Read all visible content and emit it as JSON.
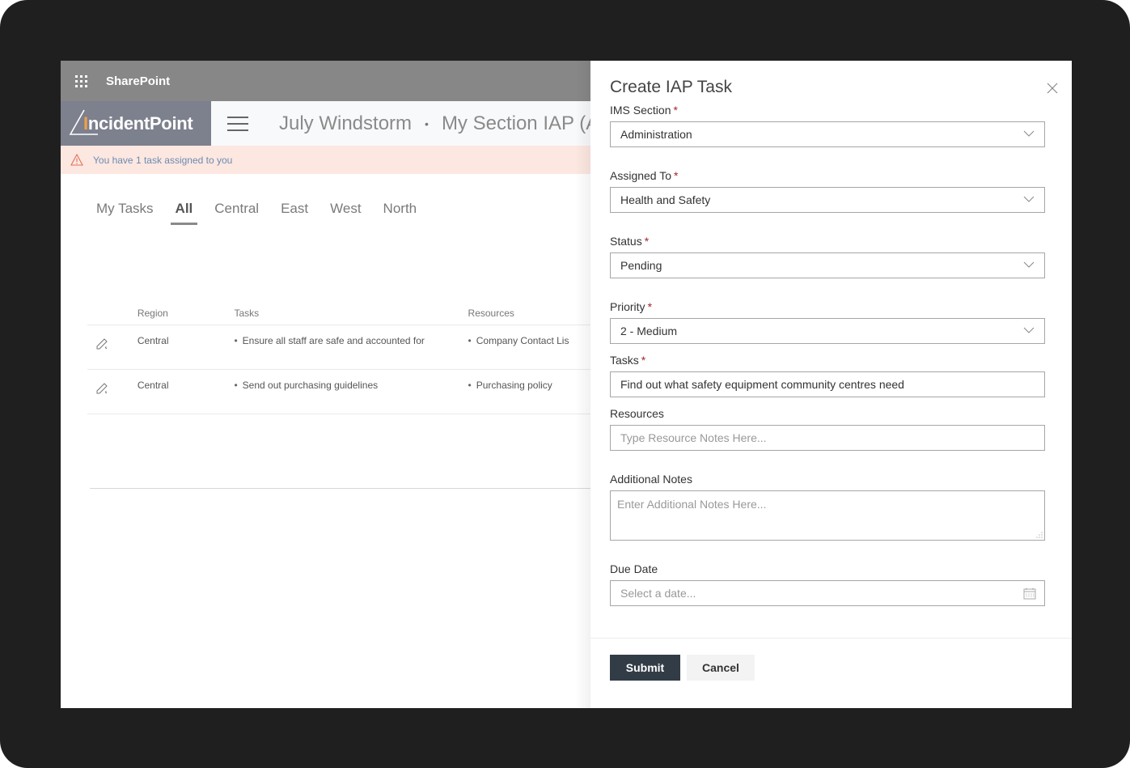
{
  "suitebar": {
    "title": "SharePoint",
    "icon": "waffle-icon"
  },
  "header": {
    "logo_text_prefix": "I",
    "logo_text": "ncidentPoint",
    "breadcrumb": [
      "July Windstorm",
      "My Section IAP (A"
    ],
    "breadcrumb_separator": "•"
  },
  "alert": {
    "icon": "warning-icon",
    "text": "You have 1 task assigned to you"
  },
  "tabs": [
    {
      "label": "My Tasks",
      "active": false
    },
    {
      "label": "All",
      "active": true
    },
    {
      "label": "Central",
      "active": false
    },
    {
      "label": "East",
      "active": false
    },
    {
      "label": "West",
      "active": false
    },
    {
      "label": "North",
      "active": false
    }
  ],
  "table": {
    "headers": {
      "region": "Region",
      "tasks": "Tasks",
      "resources": "Resources"
    },
    "rows": [
      {
        "region": "Central",
        "task": "Ensure all staff are safe and accounted for",
        "resource": "Company Contact Lis"
      },
      {
        "region": "Central",
        "task": "Send out purchasing guidelines",
        "resource": "Purchasing policy"
      }
    ]
  },
  "panel": {
    "title": "Create IAP Task",
    "fields": {
      "ims_section": {
        "label": "IMS Section",
        "required": "*",
        "value": "Administration"
      },
      "assigned_to": {
        "label": "Assigned To",
        "required": "*",
        "value": "Health and Safety"
      },
      "status": {
        "label": "Status",
        "required": "*",
        "value": "Pending"
      },
      "priority": {
        "label": "Priority",
        "required": "*",
        "value": "2 - Medium"
      },
      "tasks": {
        "label": "Tasks",
        "required": "*",
        "value": "Find out what safety equipment community centres need"
      },
      "resources": {
        "label": "Resources",
        "placeholder": "Type Resource Notes Here..."
      },
      "additional_notes": {
        "label": "Additional Notes",
        "placeholder": "Enter Additional Notes Here..."
      },
      "due_date": {
        "label": "Due Date",
        "placeholder": "Select a date..."
      }
    },
    "submit_label": "Submit",
    "cancel_label": "Cancel"
  },
  "colors": {
    "suitebar": "#878787",
    "logo_bg": "#7d808d",
    "alert_bg": "#fde7e1",
    "alert_text": "#6a8bb0",
    "submit_bg": "#323c46",
    "required": "#a4262c",
    "logo_accent": "#f0a04b"
  }
}
